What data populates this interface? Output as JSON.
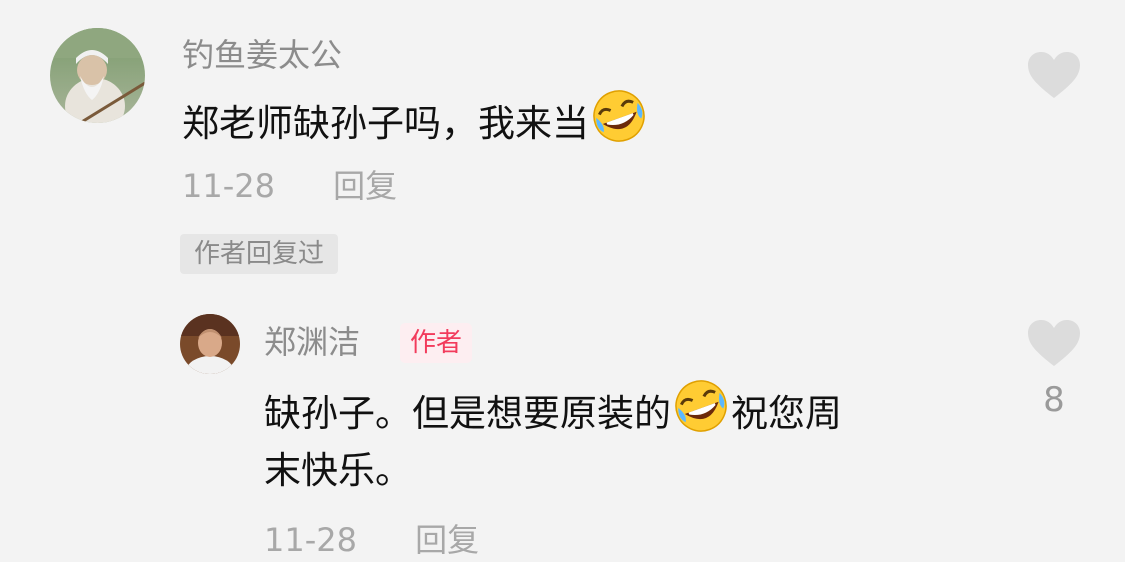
{
  "comment": {
    "username": "钓鱼姜太公",
    "text_main": "郑老师缺孙子吗，我来当",
    "emoji": "rofl-emoji",
    "date": "11-28",
    "reply_label": "回复",
    "author_replied_tag": "作者回复过",
    "like_icon": "heart-icon"
  },
  "reply": {
    "username": "郑渊洁",
    "badge": "作者",
    "line1_before_emoji": "缺孙子。但是想要原装的",
    "line1_after_emoji": "祝您周",
    "line2": "末快乐。",
    "emoji": "rofl-emoji",
    "date": "11-28",
    "reply_label": "回复",
    "like_icon": "heart-icon",
    "like_count": "8"
  },
  "colors": {
    "background": "#f3f3f3",
    "username": "#8c8c8c",
    "meta": "#a8a8a8",
    "heart": "#dcdcdc",
    "author_badge_text": "#f23b5c",
    "author_badge_bg": "#fdeef1"
  }
}
